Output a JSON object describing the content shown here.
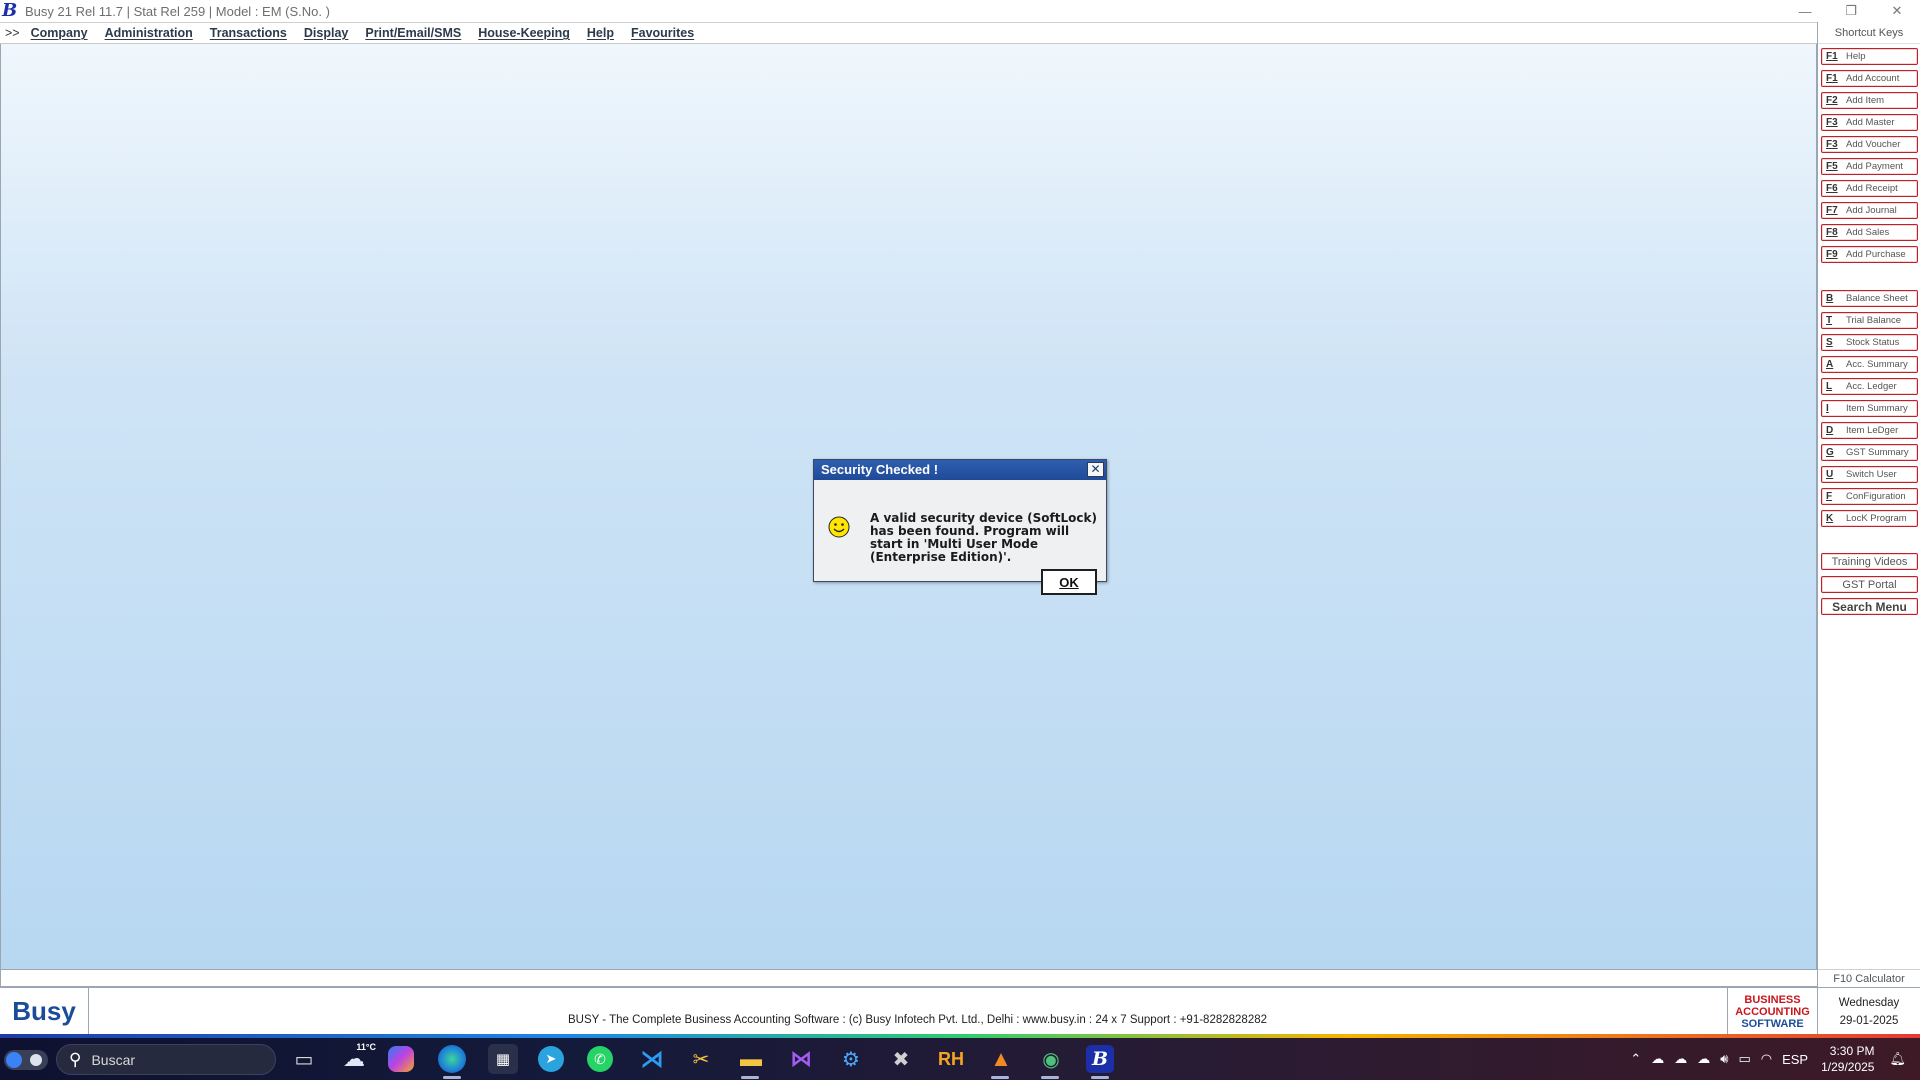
{
  "window": {
    "title": "Busy 21  Rel 11.7  |  Stat Rel 259  |  Model : EM (S.No. )",
    "minimize": "—",
    "restore": "❐",
    "close": "✕"
  },
  "menu": {
    "toggle": ">>",
    "items": [
      "Company",
      "Administration",
      "Transactions",
      "Display",
      "Print/Email/SMS",
      "House-Keeping",
      "Help",
      "Favourites"
    ]
  },
  "shortcuts": {
    "title": "Shortcut Keys",
    "group1": [
      {
        "key": "F1",
        "label": "Help"
      },
      {
        "key": "F1",
        "label": "Add Account"
      },
      {
        "key": "F2",
        "label": "Add Item"
      },
      {
        "key": "F3",
        "label": "Add Master"
      },
      {
        "key": "F3",
        "label": "Add Voucher"
      },
      {
        "key": "F5",
        "label": "Add Payment"
      },
      {
        "key": "F6",
        "label": "Add Receipt"
      },
      {
        "key": "F7",
        "label": "Add Journal"
      },
      {
        "key": "F8",
        "label": "Add Sales"
      },
      {
        "key": "F9",
        "label": "Add Purchase"
      }
    ],
    "group2": [
      {
        "key": "B",
        "label": "Balance Sheet"
      },
      {
        "key": "T",
        "label": "Trial Balance"
      },
      {
        "key": "S",
        "label": "Stock Status"
      },
      {
        "key": "A",
        "label": "Acc. Summary"
      },
      {
        "key": "L",
        "label": "Acc. Ledger"
      },
      {
        "key": "I",
        "label": "Item Summary"
      },
      {
        "key": "D",
        "label": "Item LeDger"
      },
      {
        "key": "G",
        "label": "GST Summary"
      },
      {
        "key": "U",
        "label": "Switch User"
      },
      {
        "key": "F",
        "label": "ConFiguration"
      },
      {
        "key": "K",
        "label": "LocK Program"
      }
    ],
    "training_videos": "Training Videos",
    "gst_portal": "GST Portal",
    "search_menu": "Search Menu",
    "calculator": "F10 Calculator"
  },
  "footer": {
    "logo": "Busy",
    "text": "BUSY - The Complete Business Accounting Software  :  (c) Busy Infotech Pvt. Ltd., Delhi  :  www.busy.in  :  24 x 7 Support : +91-8282828282",
    "badge_line1": "BUSINESS",
    "badge_line2": "ACCOUNTING",
    "badge_line3": "SOFTWARE",
    "day": "Wednesday",
    "date": "29-01-2025"
  },
  "dialog": {
    "title": "Security Checked !",
    "close": "✕",
    "message": "A valid security device (SoftLock) has been found. Program will start in 'Multi User Mode (Enterprise Edition)'.",
    "ok": "OK"
  },
  "taskbar": {
    "search_placeholder": "Buscar",
    "weather": "11°C",
    "language": "ESP",
    "time": "3:30 PM",
    "date": "1/29/2025"
  }
}
